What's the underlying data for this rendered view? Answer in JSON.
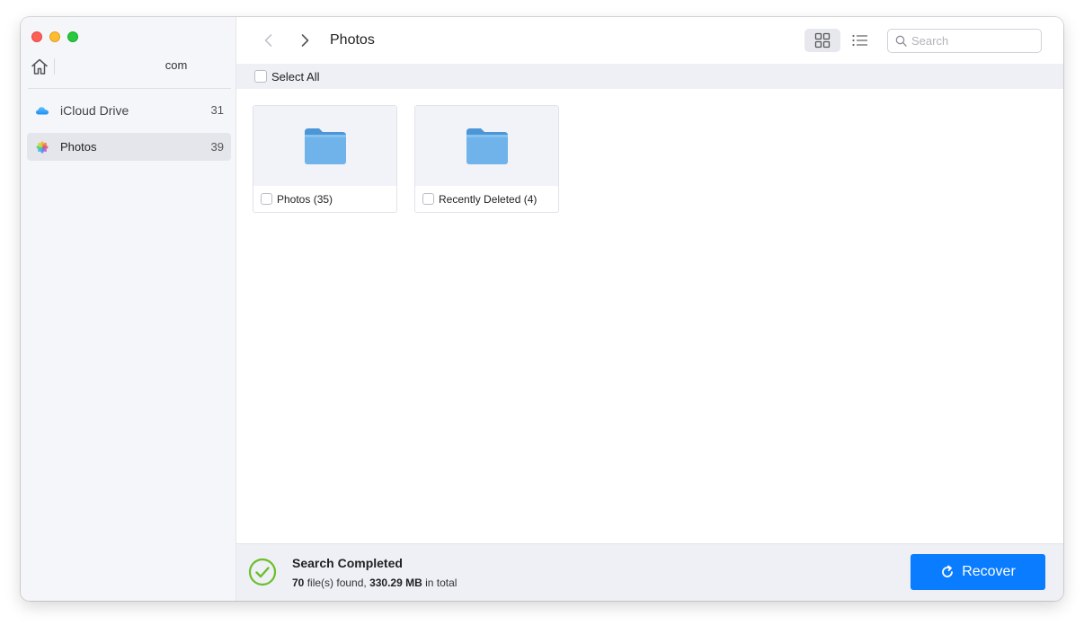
{
  "sidebar": {
    "device_name": "com",
    "items": [
      {
        "label": "iCloud Drive",
        "count": "31",
        "icon": "icloud-icon"
      },
      {
        "label": "Photos",
        "count": "39",
        "icon": "photos-icon",
        "selected": true
      }
    ]
  },
  "toolbar": {
    "title": "Photos",
    "search_placeholder": "Search"
  },
  "select_bar": {
    "select_all_label": "Select All"
  },
  "folders": [
    {
      "name": "Photos (35)"
    },
    {
      "name": "Recently Deleted (4)"
    }
  ],
  "status": {
    "title": "Search Completed",
    "file_count": "70",
    "files_text": " file(s) found, ",
    "size": "330.29 MB",
    "total_text": " in total"
  },
  "recover": {
    "label": "Recover"
  },
  "colors": {
    "accent": "#0a7cff",
    "success": "#6bbf2a",
    "folder": "#6fb3ea"
  }
}
